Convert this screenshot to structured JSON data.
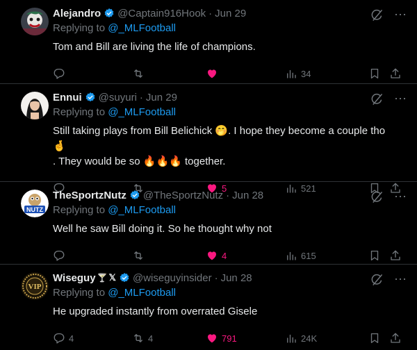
{
  "tweets": [
    {
      "name": "Alejandro",
      "badge_x": "",
      "handle": "@Captain916Hook",
      "time": "Jun 29",
      "replying_prefix": "Replying to ",
      "replying_to": "@_MLFootball",
      "text": "Tom and Bill are living the life of champions.",
      "replies": "",
      "retweets": "",
      "likes": "",
      "liked": true,
      "views": "34",
      "avatar_icon": "clown-avatar"
    },
    {
      "name": "Ennui",
      "badge_x": "",
      "handle": "@suyuri",
      "time": "Jun 29",
      "replying_prefix": "Replying to ",
      "replying_to": "@_MLFootball",
      "text_line1": "Still taking plays from Bill Belichick 🤭. I hope they become a couple tho 🤞",
      "text_line2": ". They would be so 🔥🔥🔥 together.",
      "replies": "",
      "retweets": "",
      "likes": "5",
      "liked": true,
      "views": "521",
      "avatar_icon": "woman-avatar"
    },
    {
      "name": "TheSportzNutz",
      "badge_x": "",
      "handle": "@TheSportzNutz",
      "time": "Jun 28",
      "replying_prefix": "Replying to ",
      "replying_to": "@_MLFootball",
      "text": "Well he saw Bill doing it. So he thought why not",
      "replies": "",
      "retweets": "",
      "likes": "4",
      "liked": true,
      "views": "615",
      "avatar_icon": "nutz-logo-avatar",
      "avatar_label": "NUTZ"
    },
    {
      "name": "Wiseguy",
      "badge_x": "𝕏",
      "handle": "@wiseguyinsider",
      "time": "Jun 28",
      "replying_prefix": "Replying to ",
      "replying_to": "@_MLFootball",
      "text": "He upgraded instantly from overrated Gisele",
      "replies": "4",
      "retweets": "4",
      "likes": "791",
      "liked": true,
      "views": "24K",
      "avatar_icon": "vip-badge-avatar",
      "avatar_label": "VIP"
    }
  ],
  "colors": {
    "background": "#000000",
    "accent": "#1d9bf0",
    "like": "#f91880",
    "muted": "#71767b",
    "divider": "#2f3336"
  }
}
